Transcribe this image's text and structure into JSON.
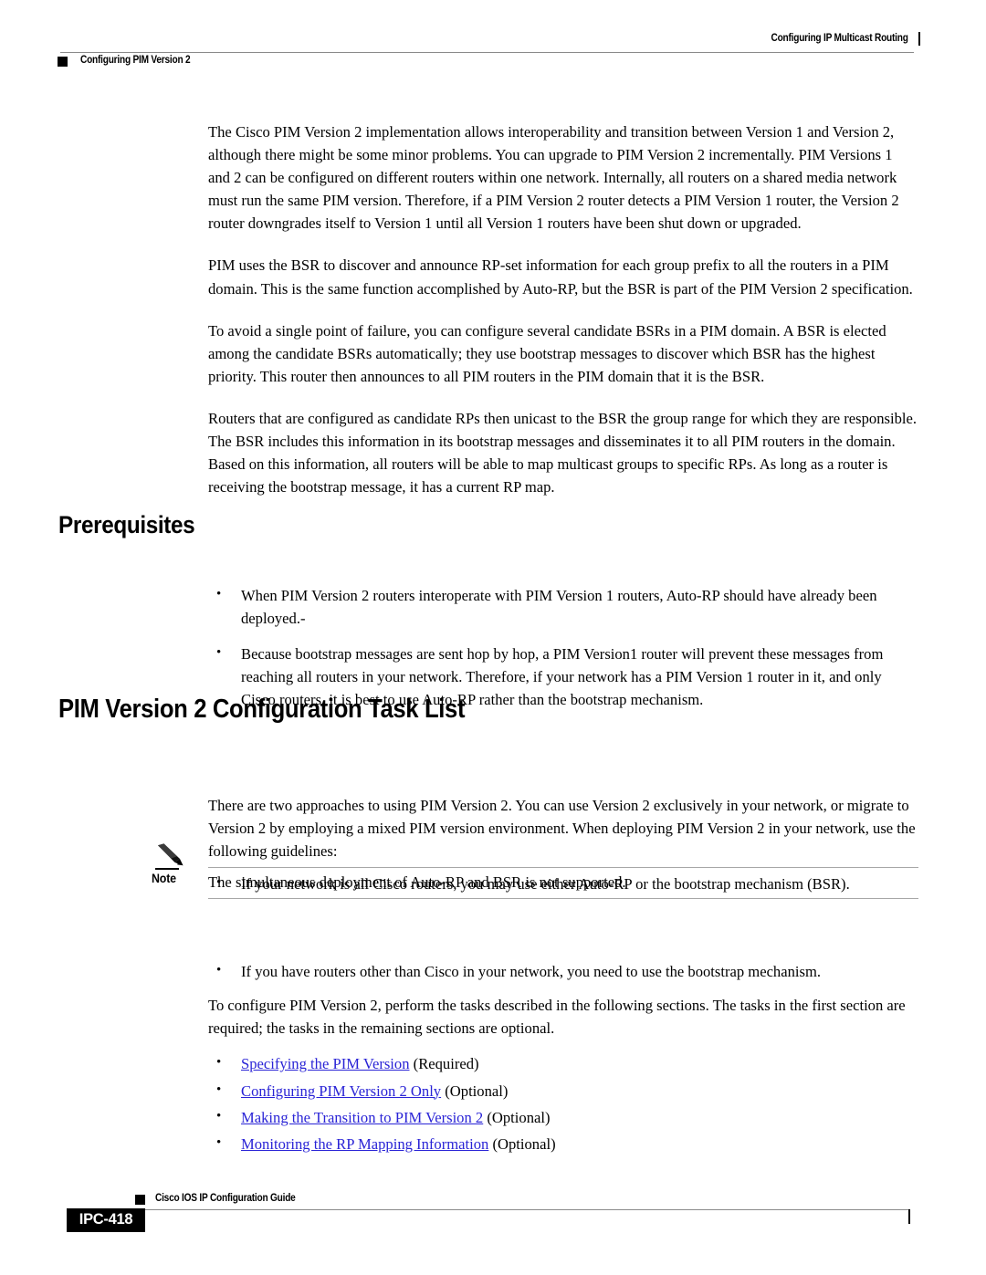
{
  "header": {
    "left_title": "Configuring PIM Version 2",
    "right_title": "Configuring IP Multicast Routing"
  },
  "body": {
    "paragraphs": [
      "The Cisco PIM Version 2 implementation allows interoperability and transition between Version 1 and Version 2, although there might be some minor problems. You can upgrade to PIM Version 2 incrementally. PIM Versions 1 and 2 can be configured on different routers within one network. Internally, all routers on a shared media network must run the same PIM version. Therefore, if a PIM Version 2 router detects a PIM Version 1 router, the Version 2 router downgrades itself to Version 1 until all Version 1 routers have been shut down or upgraded.",
      "PIM uses the BSR to discover and announce RP-set information for each group prefix to all the routers in a PIM domain. This is the same function accomplished by Auto-RP, but the BSR is part of the PIM Version 2 specification.",
      "To avoid a single point of failure, you can configure several candidate BSRs in a PIM domain. A BSR is elected among the candidate BSRs automatically; they use bootstrap messages to discover which BSR has the highest priority. This router then announces to all PIM routers in the PIM domain that it is the BSR.",
      "Routers that are configured as candidate RPs then unicast to the BSR the group range for which they are responsible. The BSR includes this information in its bootstrap messages and disseminates it to all PIM routers in the domain. Based on this information, all routers will be able to map multicast groups to specific RPs. As long as a router is receiving the bootstrap message, it has a current RP map."
    ]
  },
  "prerequisites": {
    "heading": "Prerequisites",
    "bullets": [
      "When PIM Version 2 routers interoperate with PIM Version 1 routers, Auto-RP should have already been deployed.-",
      "Because bootstrap messages are sent hop by hop, a PIM Version1 router will prevent these messages from reaching all routers in your network. Therefore, if your network has a PIM Version 1 router in it, and only Cisco routers, it is best to use Auto-RP rather than the bootstrap mechanism."
    ]
  },
  "task_list": {
    "heading": "PIM Version 2 Configuration Task List",
    "intro": "There are two approaches to using PIM Version 2. You can use Version 2 exclusively in your network, or migrate to Version 2 by employing a mixed PIM version environment. When deploying PIM Version 2 in your network, use the following guidelines:",
    "bullet_before_note": "If your network is all Cisco routers, you may use either Auto-RP or the bootstrap mechanism (BSR).",
    "note": {
      "label": "Note",
      "icon": "pencil-icon",
      "text": "The simultaneous deployment of Auto-RP and BSR is not supported."
    },
    "bullet_after_note": "If you have routers other than Cisco in your network, you need to use the bootstrap mechanism.",
    "closing": "To configure PIM Version 2, perform the tasks described in the following sections. The tasks in the first section are required; the tasks in the remaining sections are optional.",
    "links": [
      {
        "text": "Specifying the PIM Version",
        "suffix": " (Required)"
      },
      {
        "text": "Configuring PIM Version 2 Only",
        "suffix": " (Optional)"
      },
      {
        "text": "Making the Transition to PIM Version 2",
        "suffix": " (Optional)"
      },
      {
        "text": "Monitoring the RP Mapping Information",
        "suffix": " (Optional)"
      }
    ]
  },
  "footer": {
    "guide_title": "Cisco IOS IP Configuration Guide",
    "page_number": "IPC-418"
  },
  "colors": {
    "link": "#2a24d6",
    "rule": "#8a8a8a",
    "note_rule": "#a7a7a7",
    "text": "#000000"
  }
}
